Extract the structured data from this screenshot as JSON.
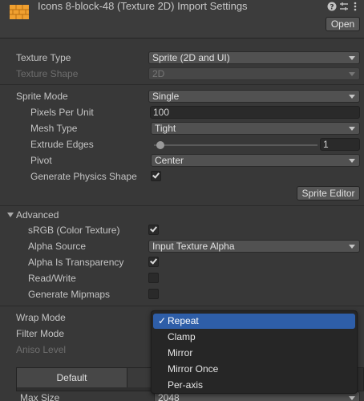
{
  "header": {
    "title": "Icons 8-block-48 (Texture 2D) Import Settings",
    "open_label": "Open"
  },
  "texture_type": {
    "label": "Texture Type",
    "value": "Sprite (2D and UI)"
  },
  "texture_shape": {
    "label": "Texture Shape",
    "value": "2D"
  },
  "sprite_mode": {
    "label": "Sprite Mode",
    "value": "Single"
  },
  "pixels_per_unit": {
    "label": "Pixels Per Unit",
    "value": "100"
  },
  "mesh_type": {
    "label": "Mesh Type",
    "value": "Tight"
  },
  "extrude_edges": {
    "label": "Extrude Edges",
    "value": "1",
    "fraction": 0.03
  },
  "pivot": {
    "label": "Pivot",
    "value": "Center"
  },
  "generate_physics_shape": {
    "label": "Generate Physics Shape",
    "checked": true
  },
  "sprite_editor_label": "Sprite Editor",
  "advanced": {
    "label": "Advanced",
    "srgb": {
      "label": "sRGB (Color Texture)",
      "checked": true
    },
    "alpha_source": {
      "label": "Alpha Source",
      "value": "Input Texture Alpha"
    },
    "alpha_is_transparency": {
      "label": "Alpha Is Transparency",
      "checked": true
    },
    "read_write": {
      "label": "Read/Write",
      "checked": false
    },
    "generate_mipmaps": {
      "label": "Generate Mipmaps",
      "checked": false
    }
  },
  "wrap_mode": {
    "label": "Wrap Mode"
  },
  "filter_mode": {
    "label": "Filter Mode"
  },
  "aniso_level": {
    "label": "Aniso Level"
  },
  "wrap_popup": {
    "selected": "Repeat",
    "items": [
      "Repeat",
      "Clamp",
      "Mirror",
      "Mirror Once",
      "Per-axis"
    ]
  },
  "platform_tabs": {
    "default_label": "Default"
  },
  "max_size": {
    "label": "Max Size",
    "value": "2048"
  },
  "colors": {
    "accent": "#2e5ea8",
    "background": "#383838",
    "brand_icon": "#f0a030"
  },
  "icons": [
    "app-texture-icon",
    "help-icon",
    "settings-sliders-icon",
    "kebab-menu-icon",
    "monitor-icon",
    "checkmark-icon",
    "dropdown-caret-icon"
  ]
}
